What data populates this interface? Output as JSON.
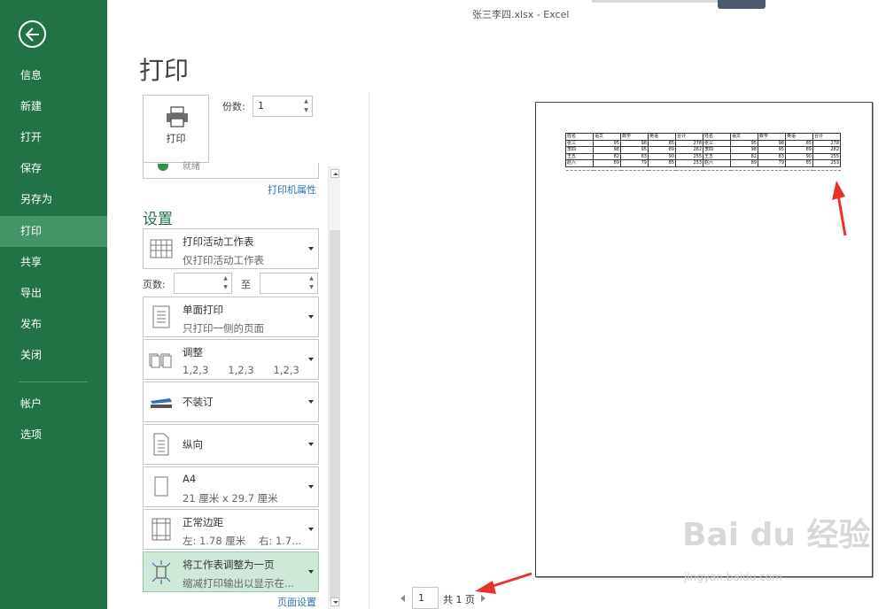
{
  "window": {
    "title": "张三李四.xlsx - Excel"
  },
  "nav": {
    "items": [
      {
        "label": "信息"
      },
      {
        "label": "新建"
      },
      {
        "label": "打开"
      },
      {
        "label": "保存"
      },
      {
        "label": "另存为"
      },
      {
        "label": "打印",
        "active": true
      },
      {
        "label": "共享"
      },
      {
        "label": "导出"
      },
      {
        "label": "发布"
      },
      {
        "label": "关闭"
      },
      {
        "label": "帐户"
      },
      {
        "label": "选项"
      }
    ]
  },
  "print": {
    "heading": "打印",
    "button_label": "打印",
    "copies_label": "份数:",
    "copies_value": "1",
    "printer_status": "就绪",
    "printer_props_link": "打印机属性"
  },
  "settings": {
    "heading": "设置",
    "what": {
      "title": "打印活动工作表",
      "sub": "仅打印活动工作表"
    },
    "pages_label": "页数:",
    "pages_to_label": "至",
    "pages_from": "",
    "pages_to": "",
    "sides": {
      "title": "单面打印",
      "sub": "只打印一侧的页面"
    },
    "collate": {
      "title": "调整",
      "sub": [
        "1,2,3",
        "1,2,3",
        "1,2,3"
      ]
    },
    "binding": {
      "title": "不装订"
    },
    "orientation": {
      "title": "纵向"
    },
    "paper": {
      "title": "A4",
      "sub": "21 厘米 x 29.7 厘米"
    },
    "margins": {
      "title": "正常边距",
      "sub": "左: 1.78 厘米    右: 1.7..."
    },
    "scaling": {
      "title": "将工作表调整为一页",
      "sub": "缩减打印输出以显示在..."
    },
    "page_setup_link": "页面设置"
  },
  "preview": {
    "page_current": "1",
    "page_total_text": "共 1 页",
    "sheet": {
      "header": [
        "姓名",
        "语文",
        "数学",
        "英语",
        "合计",
        "姓名",
        "语文",
        "数学",
        "英语",
        "合计"
      ],
      "rows": [
        [
          "张三",
          "95",
          "98",
          "85",
          "278",
          "张三",
          "95",
          "98",
          "85",
          "278"
        ],
        [
          "李四",
          "98",
          "95",
          "89",
          "282",
          "李四",
          "98",
          "95",
          "89",
          "282"
        ],
        [
          "王五",
          "82",
          "83",
          "90",
          "255",
          "王五",
          "82",
          "83",
          "90",
          "255"
        ],
        [
          "赵六",
          "89",
          "79",
          "85",
          "253",
          "赵六",
          "89",
          "79",
          "85",
          "253"
        ]
      ]
    }
  },
  "watermark": {
    "text": "Bai du 经验",
    "sub": "jingyan.baidu.com"
  },
  "colors": {
    "nav_bg": "#217346",
    "nav_active": "#439467",
    "accent": "#217346",
    "link": "#2e6fb8",
    "annotation": "#e8332a"
  }
}
